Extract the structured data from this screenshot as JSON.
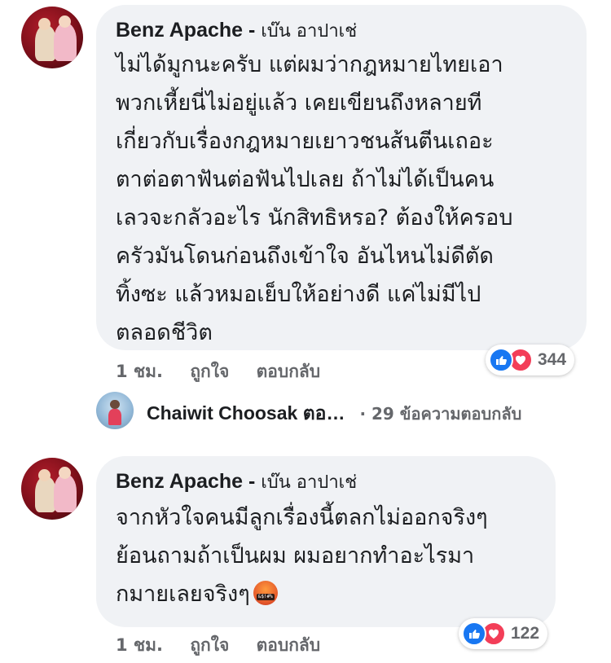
{
  "comments": [
    {
      "author": "Benz Apache",
      "author_thai": "เบ๊น อาปาเช่",
      "separator": " - ",
      "text": "ไม่ได้มูกนะครับ แต่ผมว่ากฎหมายไทยเอา\nพวกเหี้ยนี่ไม่อยู่แล้ว เคยเขียนถึงหลายที\nเกี่ยวกับเรื่องกฎหมายเยาวชนส้นตีนเถอะ\nตาต่อตาฟันต่อฟันไปเลย  ถ้าไม่ได้เป็นคน\nเลวจะกลัวอะไร  นักสิทธิหรอ?  ต้องให้ครอบ\nครัวมันโดนก่อนถึงเข้าใจ    อันไหนไม่ดีตัด\nทิ้งซะ แล้วหมอเย็บให้อย่างดี  แค่ไม่มีไป\nตลอดชีวิต",
      "time": "1 ชม.",
      "like_label": "ถูกใจ",
      "reply_label": "ตอบกลับ",
      "reaction_count": "344"
    },
    {
      "author": "Benz Apache",
      "author_thai": "เบ๊น อาปาเช่",
      "separator": " - ",
      "text": "จากหัวใจคนมีลูกเรื่องนี้ตลกไม่ออกจริงๆ\nย้อนถามถ้าเป็นผม ผมอยากทำอะไรมา\nกมายเลยจริงๆ",
      "emoji_text": "&$!#%",
      "time": "1 ชม.",
      "like_label": "ถูกใจ",
      "reply_label": "ตอบกลับ",
      "reaction_count": "122"
    }
  ],
  "reply_thread": {
    "name": "Chaiwit Choosak ตอ…",
    "count_text": "· 29 ข้อความตอบกลับ"
  },
  "icons": {
    "like": "like-icon",
    "love": "love-icon",
    "emoji": "pouting-face-emoji"
  },
  "colors": {
    "bubble": "#f0f2f5",
    "like": "#1877f2",
    "love": "#f33e58",
    "secondary_text": "#65676b"
  }
}
